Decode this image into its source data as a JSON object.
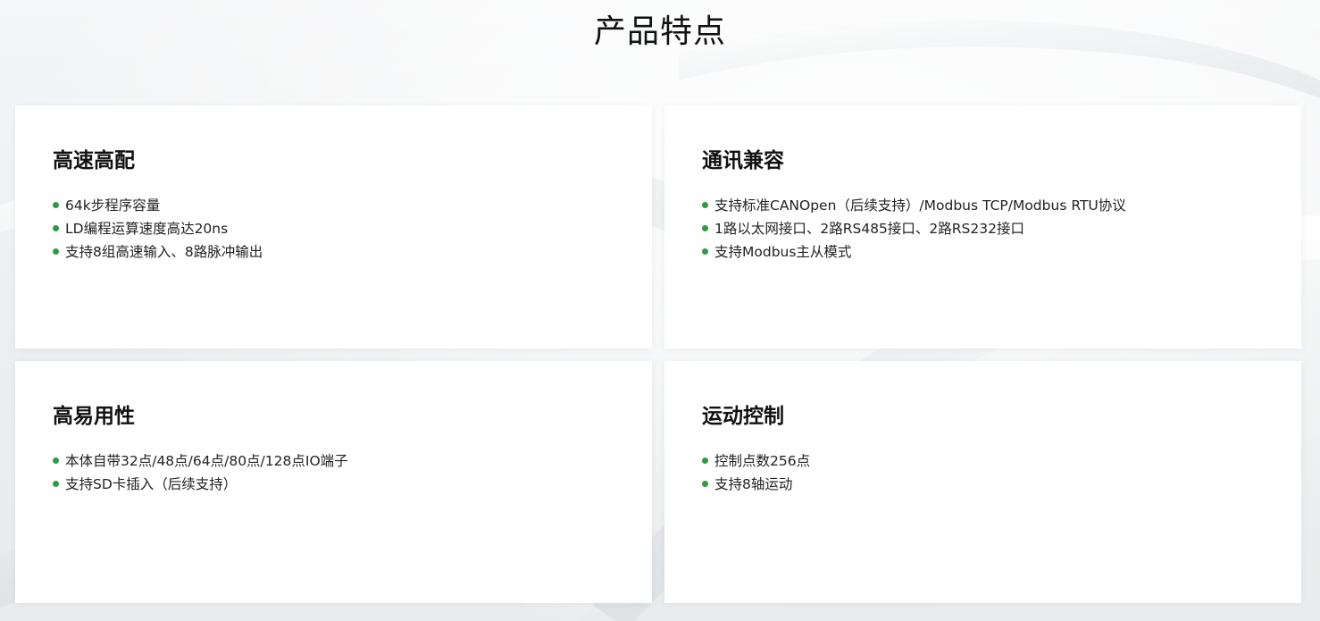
{
  "page": {
    "title": "产品特点"
  },
  "theme": {
    "accent": "#2e9a46",
    "card_bg": "#ffffff",
    "page_bg": "#eef0f1"
  },
  "cards": [
    {
      "title": "高速高配",
      "items": [
        "64k步程序容量",
        "LD编程运算速度高达20ns",
        "支持8组高速输入、8路脉冲输出"
      ]
    },
    {
      "title": "通讯兼容",
      "items": [
        "支持标准CANOpen（后续支持）/Modbus TCP/Modbus RTU协议",
        "1路以太网接口、2路RS485接口、2路RS232接口",
        "支持Modbus主从模式"
      ]
    },
    {
      "title": "高易用性",
      "items": [
        "本体自带32点/48点/64点/80点/128点IO端子",
        "支持SD卡插入（后续支持）"
      ]
    },
    {
      "title": "运动控制",
      "items": [
        "控制点数256点",
        "支持8轴运动"
      ]
    }
  ]
}
